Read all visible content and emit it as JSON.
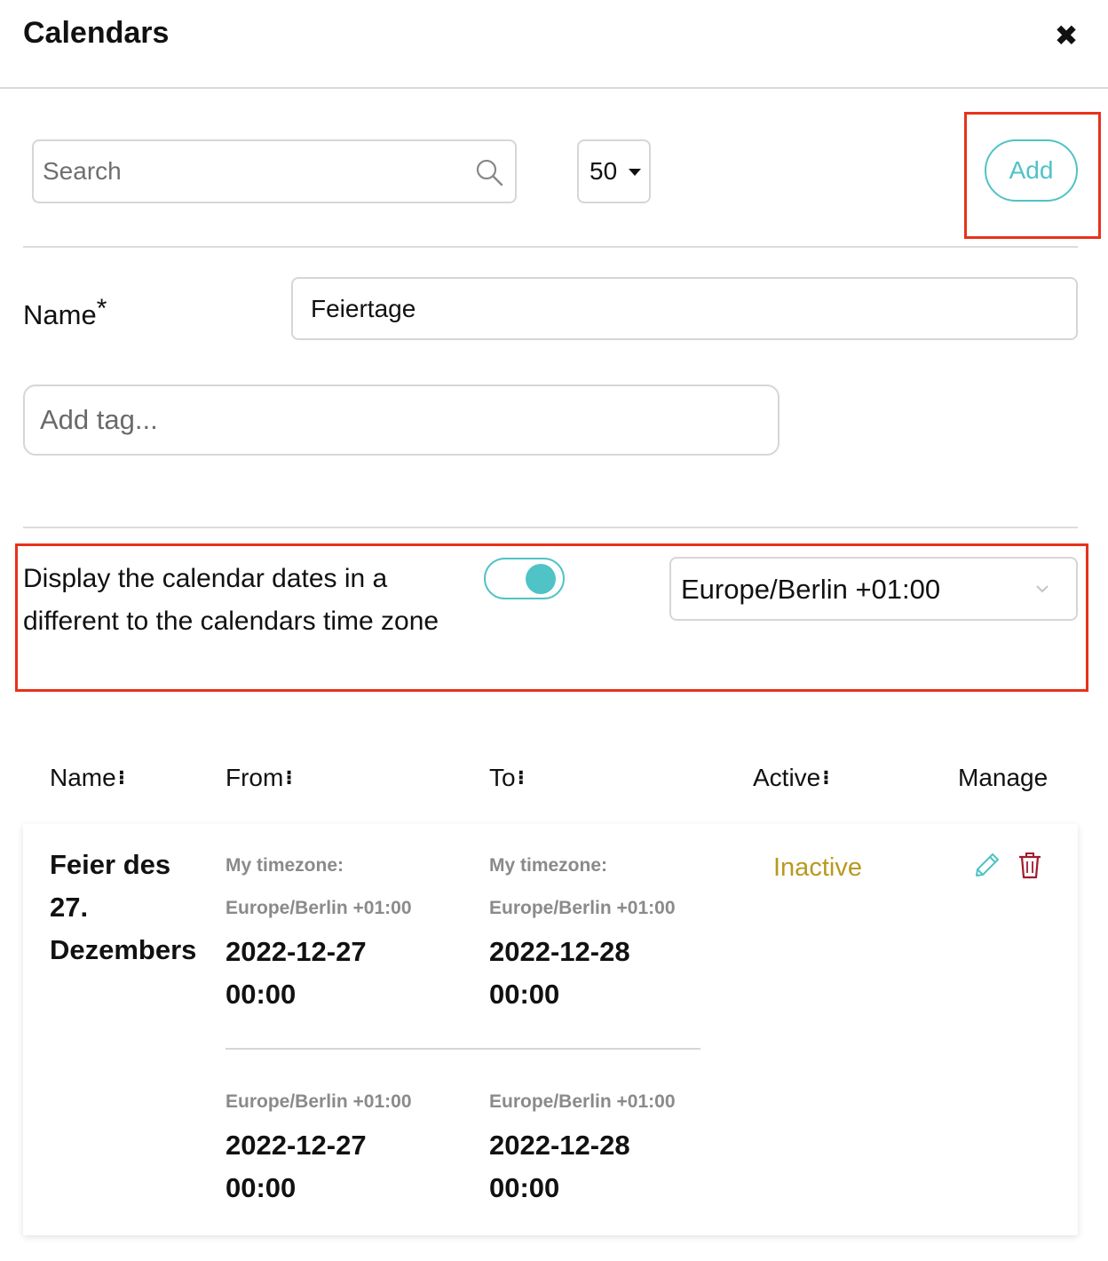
{
  "header": {
    "title": "Calendars",
    "close_label": "✖"
  },
  "toolbar": {
    "search_placeholder": "Search",
    "search_value": "",
    "page_size": "50",
    "add_label": "Add"
  },
  "form": {
    "name_label": "Name",
    "name_required_mark": "*",
    "name_value": "Feiertage",
    "tag_placeholder": "Add tag...",
    "tz_label": "Display the calendar dates in a different to the calendars time zone",
    "tz_toggle_on": true,
    "tz_value": "Europe/Berlin +01:00"
  },
  "table": {
    "headers": {
      "name": "Name",
      "from": "From",
      "to": "To",
      "active": "Active",
      "manage": "Manage"
    },
    "sort_glyph": "⁝",
    "rows": [
      {
        "name": "Feier des 27. Dezembers",
        "my_timezone_label": "My timezone:",
        "from": {
          "my_tz": "Europe/Berlin +01:00",
          "my_date": "2022-12-27",
          "my_time": "00:00",
          "cal_tz": "Europe/Berlin +01:00",
          "cal_date": "2022-12-27",
          "cal_time": "00:00"
        },
        "to": {
          "my_tz": "Europe/Berlin +01:00",
          "my_date": "2022-12-28",
          "my_time": "00:00",
          "cal_tz": "Europe/Berlin +01:00",
          "cal_date": "2022-12-28",
          "cal_time": "00:00"
        },
        "status": "Inactive"
      }
    ]
  },
  "icons": {
    "search": "search-icon",
    "page_size_caret": "caret-down-icon",
    "tz_chevron": "chevron-down-icon",
    "edit": "pencil-icon",
    "delete": "trash-icon"
  },
  "colors": {
    "accent": "#4fc3c6",
    "highlight": "#e8321a",
    "inactive": "#b89a1e",
    "delete": "#a3192b"
  }
}
